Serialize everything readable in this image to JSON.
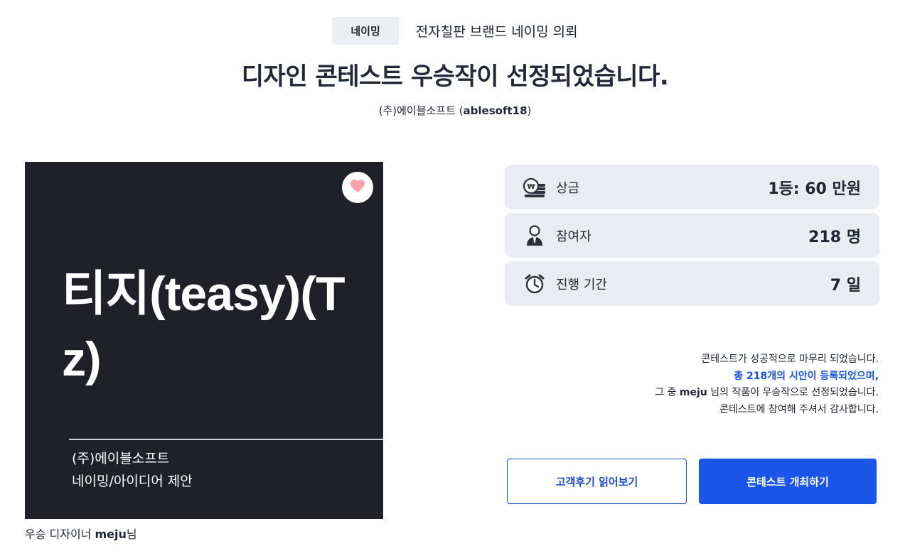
{
  "header": {
    "category": "네이밍",
    "request_title": "전자칠판 브랜드 네이밍 의뢰",
    "main_title": "디자인 콘테스트 우승작이 선정되었습니다.",
    "client_name": "(주)에이블소프트",
    "client_id": "ablesoft18"
  },
  "artwork": {
    "name": "티지(teasy)(Tz)",
    "company": "(주)에이블소프트",
    "type": "네이밍/아이디어 제안",
    "like_icon": "heart-icon",
    "colors": {
      "background": "#1f2028",
      "heart": "#f5a3a8"
    }
  },
  "designer": {
    "prefix": "우승 디자이너",
    "name": "meju",
    "suffix": "님"
  },
  "stats": [
    {
      "icon": "prize-coins-icon",
      "label": "상금",
      "value": "1등: 60 만원"
    },
    {
      "icon": "participant-person-icon",
      "label": "참여자",
      "value": "218 명"
    },
    {
      "icon": "alarm-clock-icon",
      "label": "진행 기간",
      "value": "7 일"
    }
  ],
  "result": {
    "line1": "콘테스트가 성공적으로 마무리 되었습니다.",
    "line2": "총 218개의 시안이 등록되었으며,",
    "line3_prefix": "그 중",
    "line3_name": "meju",
    "line3_suffix": "님의 작품이 우승작으로 선정되었습니다.",
    "line4": "콘테스트에 참여해 주셔서 감사합니다."
  },
  "buttons": {
    "reviews": "고객후기 읽어보기",
    "host": "콘테스트 개최하기"
  },
  "colors": {
    "accent": "#1c55ea",
    "card_bg": "#e9ecf0",
    "chip_bg": "#ebeef2"
  }
}
